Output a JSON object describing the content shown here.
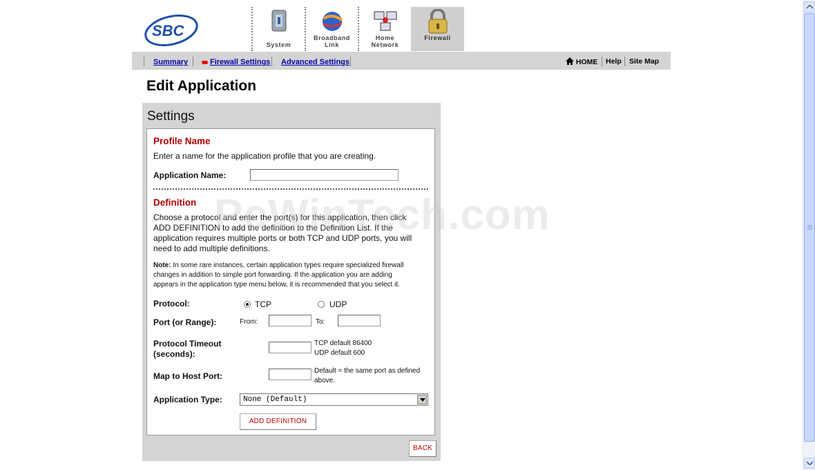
{
  "header": {
    "logo_text": "SBC",
    "nav_tabs": [
      {
        "label_line1": "System",
        "label_line2": ""
      },
      {
        "label_line1": "Broadband",
        "label_line2": "Link"
      },
      {
        "label_line1": "Home",
        "label_line2": "Network"
      },
      {
        "label_line1": "Firewall",
        "label_line2": ""
      }
    ]
  },
  "subnav": {
    "summary": "Summary",
    "firewall_settings": "Firewall Settings",
    "advanced_settings": "Advanced Settings",
    "home": "HOME",
    "help": "Help",
    "site_map": "Site Map"
  },
  "page": {
    "title": "Edit Application"
  },
  "settings": {
    "title": "Settings",
    "profile_heading": "Profile Name",
    "profile_desc": "Enter a name for the application profile that you are creating.",
    "app_name_label": "Application Name:",
    "app_name_value": "",
    "definition_heading": "Definition",
    "definition_desc_1": "Choose a protocol and enter the port(s) for this application, then click",
    "definition_desc_2": "ADD DEFINITION to add the definition to the Definition List. If the",
    "definition_desc_3": "application requires multiple ports or both TCP and UDP ports, you will",
    "definition_desc_4": "need to add multiple definitions.",
    "note_label": "Note:",
    "note_1": " In some rare instances, certain application types require specialized firewall",
    "note_2": "changes in addition to simple port forwarding. If the application you are adding",
    "note_3": "appears in the application type menu below, it is recommended that you select it.",
    "protocol_label": "Protocol:",
    "tcp": "TCP",
    "udp": "UDP",
    "protocol_selected": "TCP",
    "port_label": "Port (or Range):",
    "from_label": "From:",
    "to_label": "To:",
    "from_value": "",
    "to_value": "",
    "timeout_label_1": "Protocol Timeout",
    "timeout_label_2": "(seconds):",
    "timeout_value": "",
    "timeout_hint_1": "TCP default 86400",
    "timeout_hint_2": "UDP default 600",
    "map_label": "Map to Host Port:",
    "map_value": "",
    "map_hint_1": "Default = the same port as defined",
    "map_hint_2": "above.",
    "app_type_label": "Application Type:",
    "app_type_value": "None (Default)",
    "add_definition": "ADD DEFINITION",
    "back": "BACK"
  },
  "watermark": "PcWinTech.com",
  "colors": {
    "accent_red": "#b00000",
    "link_blue": "#0000aa",
    "panel_gray": "#d4d4d4"
  }
}
